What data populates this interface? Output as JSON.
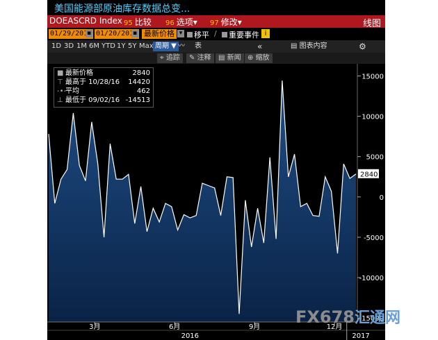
{
  "header": {
    "title": "美国能源部原油库存数据总变...",
    "ticker": "DOEASCRD Index",
    "compare_num": "95",
    "compare_label": "比较",
    "options_num": "96",
    "options_label": "选项",
    "modify_num": "97",
    "modify_label": "修改",
    "chart_type": "线图"
  },
  "date_bar": {
    "start_date": "01/29/2016",
    "end_date": "01/20/2017",
    "price_type": "最新价格",
    "moving_avg": "移平",
    "events": "重要事件"
  },
  "toolbar": {
    "zooms": [
      "1D",
      "3D",
      "1M",
      "6M",
      "YTD",
      "1Y",
      "5Y",
      "Max"
    ],
    "period": "周期",
    "table_label": "表",
    "chart_content": "图表内容"
  },
  "toolbar2": {
    "track": "追踪",
    "annotate": "注释",
    "news": "新闻",
    "zoom": "缩放"
  },
  "legend": {
    "rows": [
      {
        "label": "最新价格",
        "value": "2840"
      },
      {
        "label": "最高于 10/28/16",
        "value": "14420"
      },
      {
        "label": "平均",
        "value": "462"
      },
      {
        "label": "最低于 09/02/16",
        "value": "-14513"
      }
    ]
  },
  "colors": {
    "accent_red": "#b0181f",
    "date_orange": "#f08c00",
    "title_cyan": "#4fd0ff",
    "area_fill": "#123a6a",
    "line": "#ffffff"
  },
  "watermark": {
    "text": "FX678",
    "cn": "汇通网"
  },
  "chart_data": {
    "type": "area",
    "ylim": [
      -15500,
      16500
    ],
    "yticks": [
      15000,
      10000,
      5000,
      0,
      -5000,
      -10000,
      -15000
    ],
    "ytick_labels": [
      "15000",
      "10000",
      "5000",
      "0",
      "-5000",
      "-10000",
      "-15000"
    ],
    "xticks": [
      {
        "label": "3月",
        "week": 7.5
      },
      {
        "label": "6月",
        "week": 20.5
      },
      {
        "label": "9月",
        "week": 33.5
      },
      {
        "label": "12月",
        "week": 46.5
      }
    ],
    "years": [
      {
        "label": "2016",
        "week": 23
      },
      {
        "label": "2017",
        "week": 50.8
      }
    ],
    "year_boundary_week": 48.5,
    "last_value_label": "2840",
    "grid": false,
    "x_start": "01/29/2016",
    "x_end": "01/20/2017",
    "values": [
      7800,
      -800,
      2200,
      3400,
      10400,
      3900,
      2000,
      9300,
      4100,
      -5000,
      6600,
      2200,
      2200,
      2800,
      -3300,
      1300,
      -4300,
      -1400,
      -3100,
      -800,
      -1200,
      -4100,
      -2200,
      -2600,
      -2300,
      1700,
      1400,
      1100,
      -2300,
      2500,
      2400,
      -14513,
      -400,
      -6200,
      -1400,
      -5700,
      4900,
      -5200,
      14420,
      2500,
      5300,
      -1200,
      -800,
      -2300,
      -2400,
      2500,
      700,
      -7000,
      4100,
      2300,
      2840
    ]
  }
}
